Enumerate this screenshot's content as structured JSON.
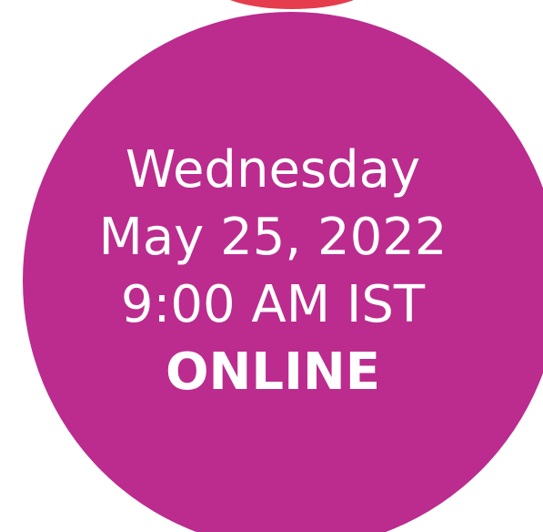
{
  "event": {
    "day": "Wednesday",
    "date": "May 25, 2022",
    "time": "9:00 AM IST",
    "mode": "ONLINE"
  },
  "colors": {
    "circle": "#bb2c8e",
    "top_arc": "#e53d4d",
    "text": "#ffffff",
    "background": "#ffffff"
  }
}
